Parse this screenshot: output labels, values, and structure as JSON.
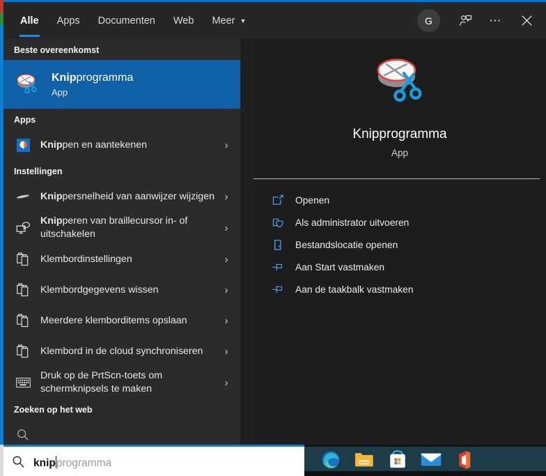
{
  "header": {
    "tabs": [
      {
        "label": "Alle",
        "active": true
      },
      {
        "label": "Apps",
        "active": false
      },
      {
        "label": "Documenten",
        "active": false
      },
      {
        "label": "Web",
        "active": false
      },
      {
        "label": "Meer",
        "active": false,
        "caret": "▼"
      }
    ],
    "avatar_initial": "G",
    "feedback_icon": "person-feedback-icon",
    "more_icon": "ellipsis-icon",
    "close_icon": "close-icon",
    "accent_color": "#0078d4"
  },
  "results": {
    "best_match_heading": "Beste overeenkomst",
    "best_match": {
      "title_bold": "Knip",
      "title_rest": "programma",
      "subtitle": "App",
      "icon": "snipping-tool-icon"
    },
    "sections": [
      {
        "heading": "Apps",
        "items": [
          {
            "bold": "Knip",
            "rest": "pen en aantekenen",
            "icon": "snip-and-sketch-icon",
            "chevron": "›"
          }
        ]
      },
      {
        "heading": "Instellingen",
        "items": [
          {
            "bold": "Knip",
            "rest": "persnelheid van aanwijzer wijzigen",
            "icon": "pointer-speed-icon",
            "chevron": "›"
          },
          {
            "bold": "Knip",
            "rest": "peren van braillecursor in- of uitschakelen",
            "icon": "braille-monitor-icon",
            "chevron": "›"
          },
          {
            "bold": "",
            "rest": "Klembordinstellingen",
            "icon": "clipboard-icon",
            "chevron": "›"
          },
          {
            "bold": "",
            "rest": "Klembordgegevens wissen",
            "icon": "clipboard-icon",
            "chevron": "›"
          },
          {
            "bold": "",
            "rest": "Meerdere klemborditems opslaan",
            "icon": "clipboard-icon",
            "chevron": "›"
          },
          {
            "bold": "",
            "rest": "Klembord in de cloud synchroniseren",
            "icon": "clipboard-icon",
            "chevron": "›"
          },
          {
            "bold": "",
            "rest": "Druk op de PrtScn-toets om schermknipsels te maken",
            "icon": "keyboard-icon",
            "chevron": "›"
          }
        ]
      },
      {
        "heading": "Zoeken op het web",
        "items": []
      }
    ]
  },
  "preview": {
    "app_name": "Knipprogramma",
    "app_kind": "App",
    "app_icon": "snipping-tool-icon",
    "actions": [
      {
        "label": "Openen",
        "icon": "open-window-icon"
      },
      {
        "label": "Als administrator uitvoeren",
        "icon": "shield-run-icon"
      },
      {
        "label": "Bestandslocatie openen",
        "icon": "folder-location-icon"
      },
      {
        "label": "Aan Start vastmaken",
        "icon": "pin-icon"
      },
      {
        "label": "Aan de taakbalk vastmaken",
        "icon": "pin-icon"
      }
    ],
    "action_icon_color": "#4aa3e8"
  },
  "search": {
    "icon": "search-icon",
    "typed_text": "knip",
    "suggestion_text": "programma",
    "full_value": "knipprogramma"
  },
  "taskbar": {
    "items": [
      {
        "name": "edge-icon",
        "label": "Microsoft Edge"
      },
      {
        "name": "file-explorer-icon",
        "label": "Verkenner"
      },
      {
        "name": "microsoft-store-icon",
        "label": "Microsoft Store"
      },
      {
        "name": "mail-icon",
        "label": "Mail"
      },
      {
        "name": "office-icon",
        "label": "Office"
      }
    ],
    "background_color": "#1c3c47"
  }
}
